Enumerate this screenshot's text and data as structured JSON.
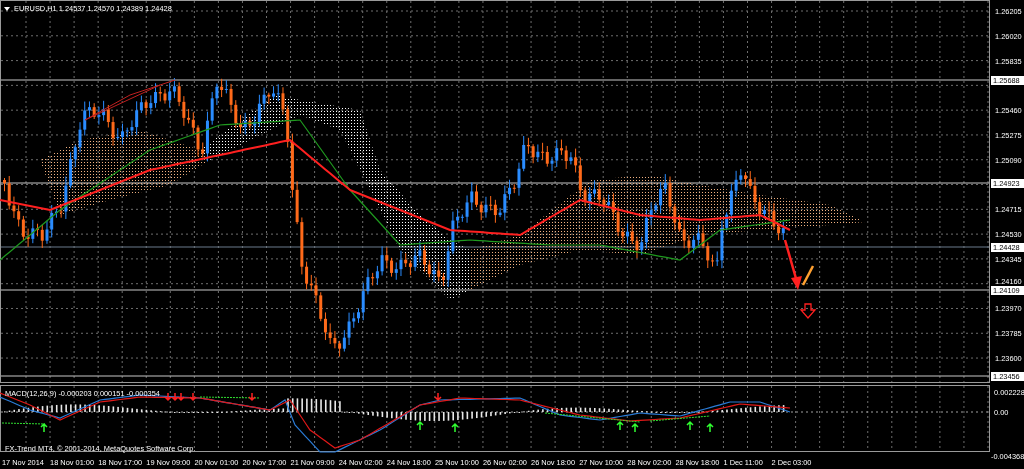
{
  "symbol_header": "EURUSD,H1 1.24537 1.24570 1.24389 1.24428",
  "price_axis": {
    "ticks": [
      "1.26205",
      "1.26020",
      "1.25835",
      "1.25460",
      "1.25275",
      "1.25090",
      "1.24715",
      "1.24530",
      "1.24345",
      "1.24160",
      "1.23970",
      "1.23785",
      "1.23600"
    ],
    "markers": [
      "1.25688",
      "1.24923",
      "1.24428",
      "1.24109",
      "1.23456"
    ]
  },
  "macd": {
    "label": "MACD(12,26,9) -0.000203 0.000151 -0.000354",
    "axis": [
      "0.002228",
      "0.00",
      "-0.004368"
    ]
  },
  "copyright": "FX-Trend MT4, © 2001-2014, MetaQuotes Software Corp.",
  "time_axis": [
    "17 Nov 2014",
    "18 Nov 01:00",
    "18 Nov 17:00",
    "19 Nov 09:00",
    "20 Nov 01:00",
    "20 Nov 17:00",
    "21 Nov 09:00",
    "24 Nov 02:00",
    "24 Nov 18:00",
    "25 Nov 10:00",
    "26 Nov 02:00",
    "26 Nov 18:00",
    "27 Nov 10:00",
    "28 Nov 02:00",
    "28 Nov 18:00",
    "1 Dec 11:00",
    "2 Dec 03:00"
  ]
}
